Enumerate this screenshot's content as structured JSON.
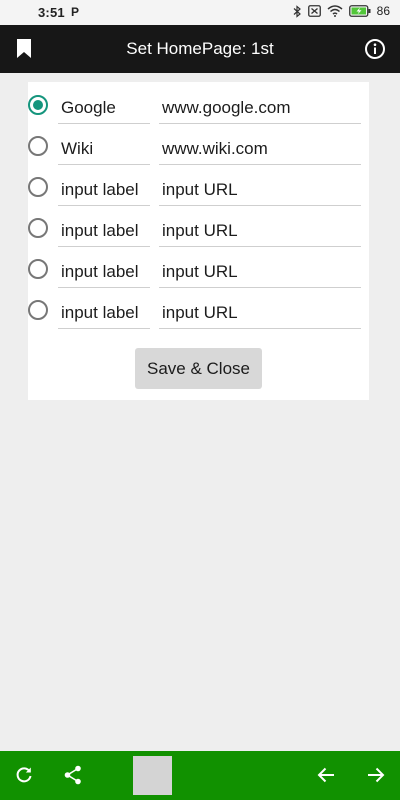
{
  "status_bar": {
    "time": "3:51",
    "p_indicator": "P",
    "battery": "86",
    "icons": [
      "bluetooth-icon",
      "mute-icon",
      "wifi-icon",
      "battery-icon"
    ]
  },
  "app_bar": {
    "title": "Set HomePage: 1st",
    "left_icon": "bookmark-icon",
    "right_icon": "info-icon"
  },
  "homepages": [
    {
      "label": "Google",
      "url": "www.google.com",
      "selected": true
    },
    {
      "label": "Wiki",
      "url": "www.wiki.com",
      "selected": false
    },
    {
      "label": "input label",
      "url": "input URL",
      "selected": false
    },
    {
      "label": "input label",
      "url": "input URL",
      "selected": false
    },
    {
      "label": "input label",
      "url": "input URL",
      "selected": false
    },
    {
      "label": "input label",
      "url": "input URL",
      "selected": false
    }
  ],
  "save_button": {
    "label": "Save & Close"
  },
  "bottom_bar": {
    "icons": [
      "refresh-icon",
      "share-icon",
      "tab-thumbnail",
      "back-arrow-icon",
      "forward-arrow-icon"
    ]
  },
  "colors": {
    "accent": "#15957d",
    "app_bar": "#171717",
    "bottom_bar": "#119100",
    "background": "#eeeeee"
  }
}
